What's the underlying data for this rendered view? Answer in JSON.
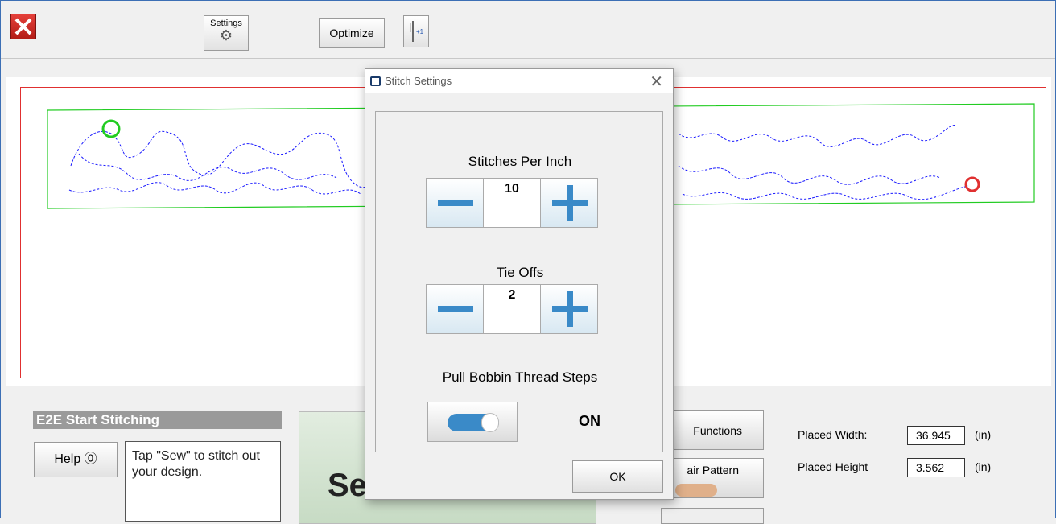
{
  "toolbar": {
    "close_icon": "close-x-icon",
    "settings_label": "Settings",
    "optimize_label": "Optimize",
    "needle_label": "+1"
  },
  "bottom": {
    "panel_title": "E2E Start Stitching",
    "help_label": "Help ⓪",
    "help_text": "Tap \"Sew\" to stitch out your design.",
    "sew_label": "Se",
    "functions_label": "Functions",
    "repair_label": "air Pattern",
    "placed_width_label": "Placed Width:",
    "placed_width_value": "36.945",
    "placed_width_unit": "(in)",
    "placed_height_label": "Placed Height",
    "placed_height_value": "3.562",
    "placed_height_unit": "(in)"
  },
  "dialog": {
    "title": "Stitch Settings",
    "close_glyph": "✕",
    "stitches_label": "Stitches Per Inch",
    "stitches_value": "10",
    "tieoffs_label": "Tie Offs",
    "tieoffs_value": "2",
    "bobbin_label": "Pull Bobbin Thread Steps",
    "bobbin_state": "ON",
    "ok_label": "OK"
  },
  "colors": {
    "frame_red": "#e03030",
    "pattern_green": "#22cc22",
    "stitch_blue": "#1a1aff",
    "accent_blue": "#3a8ac8"
  }
}
